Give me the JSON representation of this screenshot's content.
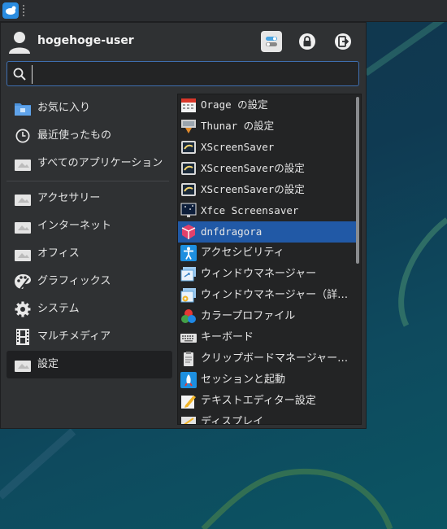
{
  "user": {
    "name": "hogehoge-user"
  },
  "search": {
    "value": "",
    "placeholder": ""
  },
  "categories": [
    {
      "label": "お気に入り",
      "icon": "folder-favorites-icon"
    },
    {
      "label": "最近使ったもの",
      "icon": "clock-icon"
    },
    {
      "label": "すべてのアプリケーション",
      "icon": "generic-app-icon"
    },
    {
      "label": "アクセサリー",
      "icon": "generic-app-icon"
    },
    {
      "label": "インターネット",
      "icon": "generic-app-icon"
    },
    {
      "label": "オフィス",
      "icon": "generic-app-icon"
    },
    {
      "label": "グラフィックス",
      "icon": "palette-icon"
    },
    {
      "label": "システム",
      "icon": "gear-icon"
    },
    {
      "label": "マルチメディア",
      "icon": "film-icon"
    },
    {
      "label": "設定",
      "icon": "generic-app-icon",
      "selected": true
    }
  ],
  "apps": [
    {
      "label": "Orage の設定",
      "icon": "calendar-icon"
    },
    {
      "label": "Thunar の設定",
      "icon": "file-manager-icon"
    },
    {
      "label": "XScreenSaver",
      "icon": "screensaver-icon"
    },
    {
      "label": "XScreenSaverの設定",
      "icon": "screensaver-icon"
    },
    {
      "label": "XScreenSaverの設定",
      "icon": "screensaver-icon"
    },
    {
      "label": "Xfce Screensaver",
      "icon": "xfce-screensaver-icon"
    },
    {
      "label": "dnfdragora",
      "icon": "package-icon",
      "selected": true
    },
    {
      "label": "アクセシビリティ",
      "icon": "accessibility-icon"
    },
    {
      "label": "ウィンドウマネージャー",
      "icon": "window-manager-icon"
    },
    {
      "label": "ウィンドウマネージャー（詳細）",
      "icon": "window-manager-tweaks-icon"
    },
    {
      "label": "カラープロファイル",
      "icon": "color-profile-icon"
    },
    {
      "label": "キーボード",
      "icon": "keyboard-icon"
    },
    {
      "label": "クリップボードマネージャー…",
      "icon": "clipboard-icon"
    },
    {
      "label": "セッションと起動",
      "icon": "session-icon"
    },
    {
      "label": "テキストエディター設定",
      "icon": "text-editor-icon"
    },
    {
      "label": "ディスプレイ",
      "icon": "display-icon"
    }
  ],
  "colors": {
    "accent": "#2159a6",
    "search_border": "#3f6fb0"
  }
}
